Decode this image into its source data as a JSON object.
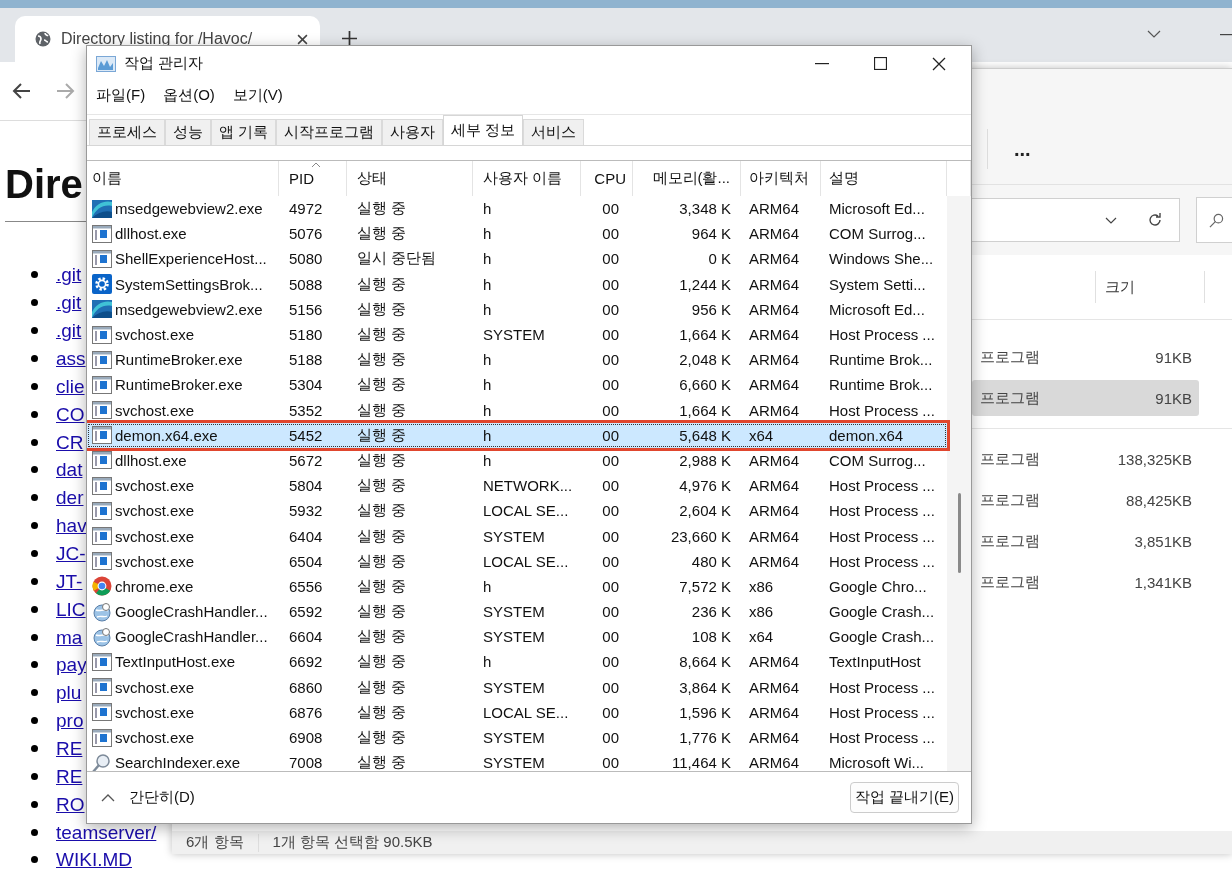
{
  "browser": {
    "tab_title": "Directory listing for /Havoc/",
    "heading": "Dire",
    "links": [
      ".git",
      ".git",
      ".git",
      "ass",
      "clie",
      "CO",
      "CR",
      "dat",
      "der",
      "hav",
      "JC-",
      "JT-",
      "LIC",
      "ma",
      "pay",
      "plu",
      "pro",
      "RE",
      "RE",
      "RO",
      "teamserver/",
      "WIKI.MD"
    ]
  },
  "explorer": {
    "more_button": "...",
    "size_header": "크기",
    "rows": [
      {
        "type": "프로그램",
        "size": "91KB",
        "selected": false
      },
      {
        "type": "프로그램",
        "size": "91KB",
        "selected": true
      },
      {
        "type": "프로그램",
        "size": "138,325KB",
        "selected": false
      },
      {
        "type": "프로그램",
        "size": "88,425KB",
        "selected": false
      },
      {
        "type": "프로그램",
        "size": "3,851KB",
        "selected": false
      },
      {
        "type": "프로그램",
        "size": "1,341KB",
        "selected": false
      }
    ],
    "status_bar": {
      "items": "6개 항목",
      "selection": "1개 항목 선택함 90.5KB"
    }
  },
  "task_manager": {
    "title": "작업 관리자",
    "menus": [
      "파일(F)",
      "옵션(O)",
      "보기(V)"
    ],
    "tabs": [
      {
        "label": "프로세스",
        "selected": false
      },
      {
        "label": "성능",
        "selected": false
      },
      {
        "label": "앱 기록",
        "selected": false
      },
      {
        "label": "시작프로그램",
        "selected": false
      },
      {
        "label": "사용자",
        "selected": false
      },
      {
        "label": "세부 정보",
        "selected": true
      },
      {
        "label": "서비스",
        "selected": false
      }
    ],
    "columns": [
      "이름",
      "PID",
      "상태",
      "사용자 이름",
      "CPU",
      "메모리(활...",
      "아키텍처",
      "설명"
    ],
    "rows": [
      {
        "kind": "edge",
        "name": "msedgewebview2.exe",
        "pid": "4972",
        "status": "실행 중",
        "user": "h",
        "cpu": "00",
        "memory": "3,348 K",
        "arch": "ARM64",
        "description": "Microsoft Ed...",
        "selected": false,
        "marked": false
      },
      {
        "kind": "app",
        "name": "dllhost.exe",
        "pid": "5076",
        "status": "실행 중",
        "user": "h",
        "cpu": "00",
        "memory": "964 K",
        "arch": "ARM64",
        "description": "COM Surrog...",
        "selected": false,
        "marked": false
      },
      {
        "kind": "app",
        "name": "ShellExperienceHost...",
        "pid": "5080",
        "status": "일시 중단됨",
        "user": "h",
        "cpu": "00",
        "memory": "0 K",
        "arch": "ARM64",
        "description": "Windows She...",
        "selected": false,
        "marked": false
      },
      {
        "kind": "gear",
        "name": "SystemSettingsBrok...",
        "pid": "5088",
        "status": "실행 중",
        "user": "h",
        "cpu": "00",
        "memory": "1,244 K",
        "arch": "ARM64",
        "description": "System Setti...",
        "selected": false,
        "marked": false
      },
      {
        "kind": "edge",
        "name": "msedgewebview2.exe",
        "pid": "5156",
        "status": "실행 중",
        "user": "h",
        "cpu": "00",
        "memory": "956 K",
        "arch": "ARM64",
        "description": "Microsoft Ed...",
        "selected": false,
        "marked": false
      },
      {
        "kind": "app",
        "name": "svchost.exe",
        "pid": "5180",
        "status": "실행 중",
        "user": "SYSTEM",
        "cpu": "00",
        "memory": "1,664 K",
        "arch": "ARM64",
        "description": "Host Process ...",
        "selected": false,
        "marked": false
      },
      {
        "kind": "app",
        "name": "RuntimeBroker.exe",
        "pid": "5188",
        "status": "실행 중",
        "user": "h",
        "cpu": "00",
        "memory": "2,048 K",
        "arch": "ARM64",
        "description": "Runtime Brok...",
        "selected": false,
        "marked": false
      },
      {
        "kind": "app",
        "name": "RuntimeBroker.exe",
        "pid": "5304",
        "status": "실행 중",
        "user": "h",
        "cpu": "00",
        "memory": "6,660 K",
        "arch": "ARM64",
        "description": "Runtime Brok...",
        "selected": false,
        "marked": false
      },
      {
        "kind": "app",
        "name": "svchost.exe",
        "pid": "5352",
        "status": "실행 중",
        "user": "h",
        "cpu": "00",
        "memory": "1,664 K",
        "arch": "ARM64",
        "description": "Host Process ...",
        "selected": false,
        "marked": false
      },
      {
        "kind": "app",
        "name": "demon.x64.exe",
        "pid": "5452",
        "status": "실행 중",
        "user": "h",
        "cpu": "00",
        "memory": "5,648 K",
        "arch": "x64",
        "description": "demon.x64",
        "selected": true,
        "marked": true
      },
      {
        "kind": "app",
        "name": "dllhost.exe",
        "pid": "5672",
        "status": "실행 중",
        "user": "h",
        "cpu": "00",
        "memory": "2,988 K",
        "arch": "ARM64",
        "description": "COM Surrog...",
        "selected": false,
        "marked": false
      },
      {
        "kind": "app",
        "name": "svchost.exe",
        "pid": "5804",
        "status": "실행 중",
        "user": "NETWORK...",
        "cpu": "00",
        "memory": "4,976 K",
        "arch": "ARM64",
        "description": "Host Process ...",
        "selected": false,
        "marked": false
      },
      {
        "kind": "app",
        "name": "svchost.exe",
        "pid": "5932",
        "status": "실행 중",
        "user": "LOCAL SE...",
        "cpu": "00",
        "memory": "2,604 K",
        "arch": "ARM64",
        "description": "Host Process ...",
        "selected": false,
        "marked": false
      },
      {
        "kind": "app",
        "name": "svchost.exe",
        "pid": "6404",
        "status": "실행 중",
        "user": "SYSTEM",
        "cpu": "00",
        "memory": "23,660 K",
        "arch": "ARM64",
        "description": "Host Process ...",
        "selected": false,
        "marked": false
      },
      {
        "kind": "app",
        "name": "svchost.exe",
        "pid": "6504",
        "status": "실행 중",
        "user": "LOCAL SE...",
        "cpu": "00",
        "memory": "480 K",
        "arch": "ARM64",
        "description": "Host Process ...",
        "selected": false,
        "marked": false
      },
      {
        "kind": "chrome",
        "name": "chrome.exe",
        "pid": "6556",
        "status": "실행 중",
        "user": "h",
        "cpu": "00",
        "memory": "7,572 K",
        "arch": "x86",
        "description": "Google Chro...",
        "selected": false,
        "marked": false
      },
      {
        "kind": "crash",
        "name": "GoogleCrashHandler...",
        "pid": "6592",
        "status": "실행 중",
        "user": "SYSTEM",
        "cpu": "00",
        "memory": "236 K",
        "arch": "x86",
        "description": "Google Crash...",
        "selected": false,
        "marked": false
      },
      {
        "kind": "crash",
        "name": "GoogleCrashHandler...",
        "pid": "6604",
        "status": "실행 중",
        "user": "SYSTEM",
        "cpu": "00",
        "memory": "108 K",
        "arch": "x64",
        "description": "Google Crash...",
        "selected": false,
        "marked": false
      },
      {
        "kind": "app",
        "name": "TextInputHost.exe",
        "pid": "6692",
        "status": "실행 중",
        "user": "h",
        "cpu": "00",
        "memory": "8,664 K",
        "arch": "ARM64",
        "description": "TextInputHost",
        "selected": false,
        "marked": false
      },
      {
        "kind": "app",
        "name": "svchost.exe",
        "pid": "6860",
        "status": "실행 중",
        "user": "SYSTEM",
        "cpu": "00",
        "memory": "3,864 K",
        "arch": "ARM64",
        "description": "Host Process ...",
        "selected": false,
        "marked": false
      },
      {
        "kind": "app",
        "name": "svchost.exe",
        "pid": "6876",
        "status": "실행 중",
        "user": "LOCAL SE...",
        "cpu": "00",
        "memory": "1,596 K",
        "arch": "ARM64",
        "description": "Host Process ...",
        "selected": false,
        "marked": false
      },
      {
        "kind": "app",
        "name": "svchost.exe",
        "pid": "6908",
        "status": "실행 중",
        "user": "SYSTEM",
        "cpu": "00",
        "memory": "1,776 K",
        "arch": "ARM64",
        "description": "Host Process ...",
        "selected": false,
        "marked": false
      },
      {
        "kind": "search",
        "name": "SearchIndexer.exe",
        "pid": "7008",
        "status": "실행 중",
        "user": "SYSTEM",
        "cpu": "00",
        "memory": "11,464 K",
        "arch": "ARM64",
        "description": "Microsoft Wi...",
        "selected": false,
        "marked": false
      }
    ],
    "footer": {
      "collapse": "간단히(D)",
      "end_task": "작업 끝내기(E)"
    }
  }
}
